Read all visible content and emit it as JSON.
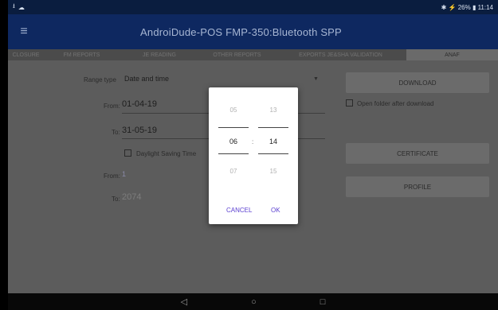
{
  "status": {
    "left_icons": [
      "usb-icon",
      "cloud-icon"
    ],
    "right_text": "✱ ⚡ 26% ▮ 11:14"
  },
  "app": {
    "title": "AndroiDude-POS    FMP-350:Bluetooth SPP"
  },
  "tabs": [
    {
      "label": "CLOSURE"
    },
    {
      "label": "FM REPORTS"
    },
    {
      "label": "JE READING"
    },
    {
      "label": "OTHER REPORTS"
    },
    {
      "label": "EXPORTS JE&SHA VALIDATION"
    },
    {
      "label": "ANAF"
    }
  ],
  "form": {
    "range_type_label": "Range type",
    "range_type_value": "Date and time",
    "from_label": "From:",
    "from_date": "01-04-19",
    "to_label": "To:",
    "to_date": "31-05-19",
    "dst_label": "Daylight Saving Time",
    "from2_label": "From:",
    "from2_value": "1",
    "to2_label": "To:",
    "to2_value": "2074"
  },
  "buttons": {
    "download": "DOWNLOAD",
    "open_folder": "Open folder after download",
    "certificate": "CERTIFICATE",
    "profile": "PROFILE"
  },
  "time_picker": {
    "hours": [
      "05",
      "06",
      "07"
    ],
    "minutes": [
      "13",
      "14",
      "15"
    ],
    "separator": ":",
    "cancel": "CANCEL",
    "ok": "OK"
  },
  "nav": {
    "back": "◁",
    "home": "○",
    "recent": "□"
  }
}
